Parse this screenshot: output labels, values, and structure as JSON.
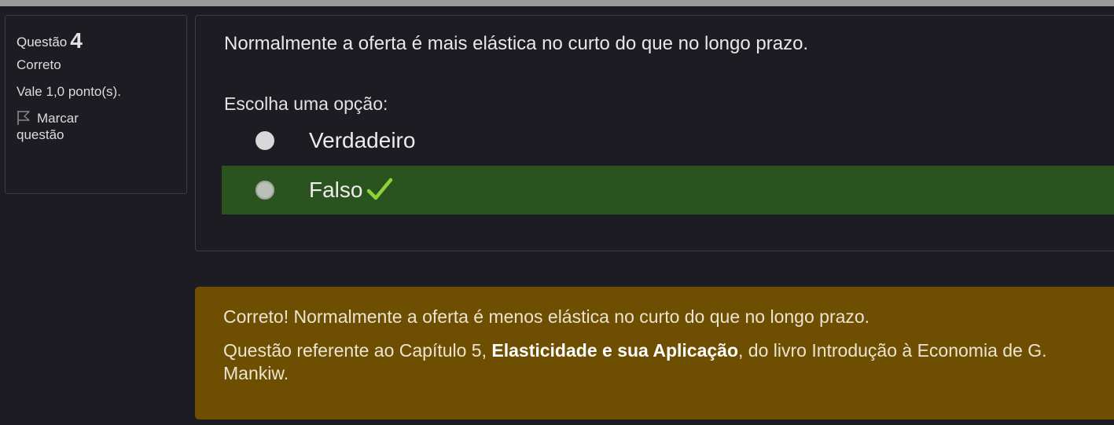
{
  "question_info": {
    "label": "Questão",
    "number": "4",
    "status": "Correto",
    "points": "Vale 1,0 ponto(s).",
    "flag_label": "Marcar",
    "flag_label_2": "questão",
    "flag_icon": "flag-icon"
  },
  "question": {
    "text": "Normalmente a oferta é mais elástica no curto do que no longo prazo.",
    "prompt": "Escolha uma opção:",
    "options": [
      {
        "label": "Verdadeiro",
        "selected": false,
        "correct": false
      },
      {
        "label": "Falso",
        "selected": true,
        "correct": true
      }
    ],
    "correct_icon": "check-icon"
  },
  "feedback": {
    "line1": "Correto! Normalmente a oferta é menos elástica no curto do que no longo prazo.",
    "line2_before": "Questão referente ao Capítulo 5, ",
    "line2_bold": "Elasticidade e sua Aplicação",
    "line2_after": ", do livro Introdução à Economia de G. Mankiw."
  },
  "colors": {
    "background": "#1c1c22",
    "correct_option_bg": "#2b5320",
    "feedback_bg": "#6e4e00",
    "check": "#8fd33a"
  }
}
